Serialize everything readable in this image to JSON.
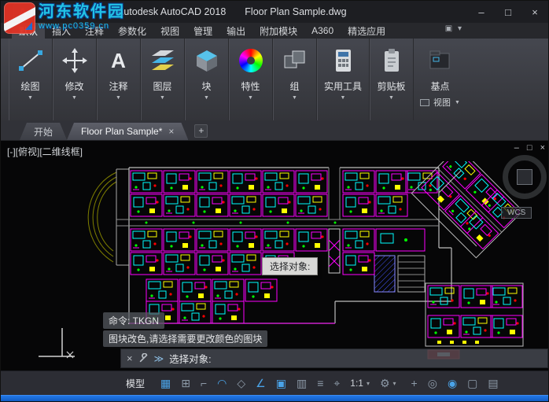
{
  "colors": {
    "accent_blue": "#1266d3",
    "active_icon_blue": "#4aa3e8",
    "plan_magenta": "#ff00ff",
    "plan_cyan": "#00ffff",
    "plan_yellow": "#ffff00",
    "plan_green": "#00ff00",
    "plan_red": "#ff0000"
  },
  "titlebar": {
    "app_title": "Autodesk AutoCAD 2018",
    "doc_title": "Floor Plan Sample.dwg",
    "app_icon_letter": "A",
    "minimize": "–",
    "maximize": "□",
    "close": "×"
  },
  "watermark": {
    "site_name": "河东软件园",
    "site_url": "www.pc0359.cn"
  },
  "ribbon": {
    "tabs": [
      {
        "label": "默认",
        "active": true
      },
      {
        "label": "插入"
      },
      {
        "label": "注释"
      },
      {
        "label": "参数化"
      },
      {
        "label": "视图"
      },
      {
        "label": "管理"
      },
      {
        "label": "输出"
      },
      {
        "label": "附加模块"
      },
      {
        "label": "A360"
      },
      {
        "label": "精选应用"
      }
    ],
    "display_toggle_glyph": "▣ ▾",
    "panel_chevron": "▼",
    "panels": [
      {
        "label": "绘图",
        "icon": "draw-line-icon"
      },
      {
        "label": "修改",
        "icon": "modify-icon"
      },
      {
        "label": "注释",
        "icon": "annotate-icon"
      },
      {
        "label": "图层",
        "icon": "layers-icon"
      },
      {
        "label": "块",
        "icon": "block-icon"
      },
      {
        "label": "特性",
        "icon": "properties-wheel-icon"
      },
      {
        "label": "组",
        "icon": "groups-icon"
      },
      {
        "label": "实用工具",
        "icon": "utilities-icon"
      },
      {
        "label": "剪贴板",
        "icon": "clipboard-icon"
      },
      {
        "label": "基点",
        "icon": "basepoint-icon"
      }
    ],
    "view_panel_label": "视图"
  },
  "file_tabs": {
    "start_tab": "开始",
    "drawing_tab": "Floor Plan Sample*",
    "close_glyph": "×",
    "new_tab_glyph": "+"
  },
  "canvas": {
    "viewport_label": "[-][俯视][二维线框]",
    "window_controls": {
      "minimize": "–",
      "restore": "□",
      "close": "×"
    },
    "wcs_label": "WCS",
    "tooltip": "选择对象:",
    "command_history": [
      "命令: TKGN",
      "图块改色,请选择需要更改颜色的图块"
    ]
  },
  "command_line": {
    "close_glyph": "×",
    "prompt_glyph": "≫",
    "prompt": "选择对象:"
  },
  "statusbar": {
    "model_label": "模型",
    "toggle_icons": [
      {
        "name": "grid-display",
        "glyph": "▦",
        "active": true
      },
      {
        "name": "snap-mode",
        "glyph": "⊞",
        "active": false
      },
      {
        "name": "ortho-mode",
        "glyph": "⌐",
        "active": false
      },
      {
        "name": "polar-tracking",
        "glyph": "◠",
        "active": true
      },
      {
        "name": "isometric-drafting",
        "glyph": "◇",
        "active": false
      },
      {
        "name": "object-snap-tracking",
        "glyph": "∠",
        "active": true
      },
      {
        "name": "object-snap",
        "glyph": "▣",
        "active": true
      },
      {
        "name": "transparency",
        "glyph": "▥",
        "active": false
      },
      {
        "name": "lineweight",
        "glyph": "≡",
        "active": false
      },
      {
        "name": "dynamic-input",
        "glyph": "⌖",
        "active": false
      }
    ],
    "scale_label": "1:1",
    "dropdown_glyph": "▾",
    "right_icons": [
      {
        "name": "workspace-gear",
        "glyph": "⚙",
        "dropdown": true
      },
      {
        "name": "annotation-monitor",
        "glyph": "+"
      },
      {
        "name": "isolate-objects",
        "glyph": "◎"
      },
      {
        "name": "graphics-performance",
        "glyph": "◉",
        "active": true
      },
      {
        "name": "clean-screen",
        "glyph": "▢"
      },
      {
        "name": "customization",
        "glyph": "▤"
      }
    ]
  }
}
